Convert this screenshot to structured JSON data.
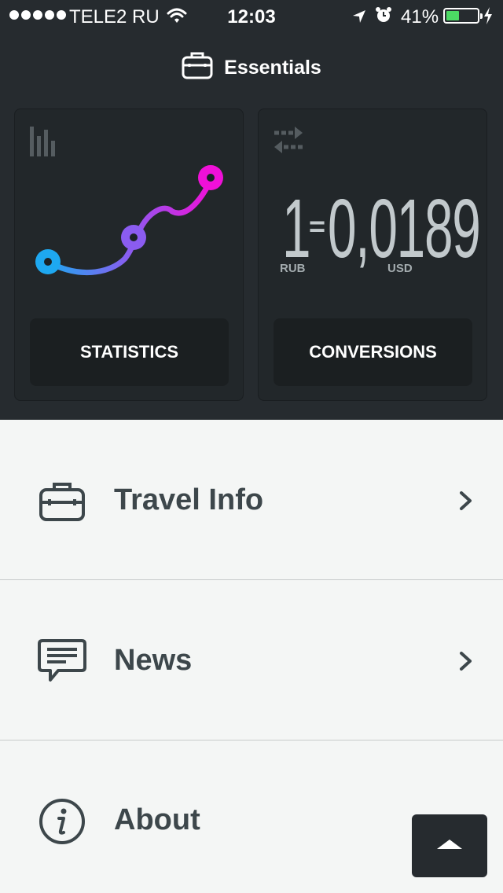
{
  "status_bar": {
    "carrier": "TELE2 RU",
    "time": "12:03",
    "battery": "41%",
    "battery_level": 0.41,
    "signal_bars": 5
  },
  "header": {
    "title": "Essentials",
    "icon": "briefcase-icon"
  },
  "cards": {
    "statistics": {
      "icon": "bar-chart-icon",
      "button_label": "STATISTICS"
    },
    "conversions": {
      "icon": "swap-arrows-icon",
      "amount_from": "1",
      "equals": "=",
      "amount_to": "0,0189",
      "currency_from": "RUB",
      "currency_to": "USD",
      "button_label": "CONVERSIONS"
    }
  },
  "menu": {
    "items": [
      {
        "label": "Travel Info",
        "icon": "briefcase-icon"
      },
      {
        "label": "News",
        "icon": "speech-bubble-icon"
      },
      {
        "label": "About",
        "icon": "info-icon"
      }
    ]
  },
  "colors": {
    "dark_bg": "#262b2f",
    "light_bg": "#f4f6f5",
    "graph_start": "#1ea8f0",
    "graph_mid": "#8b5cf0",
    "graph_end": "#f010d8"
  }
}
